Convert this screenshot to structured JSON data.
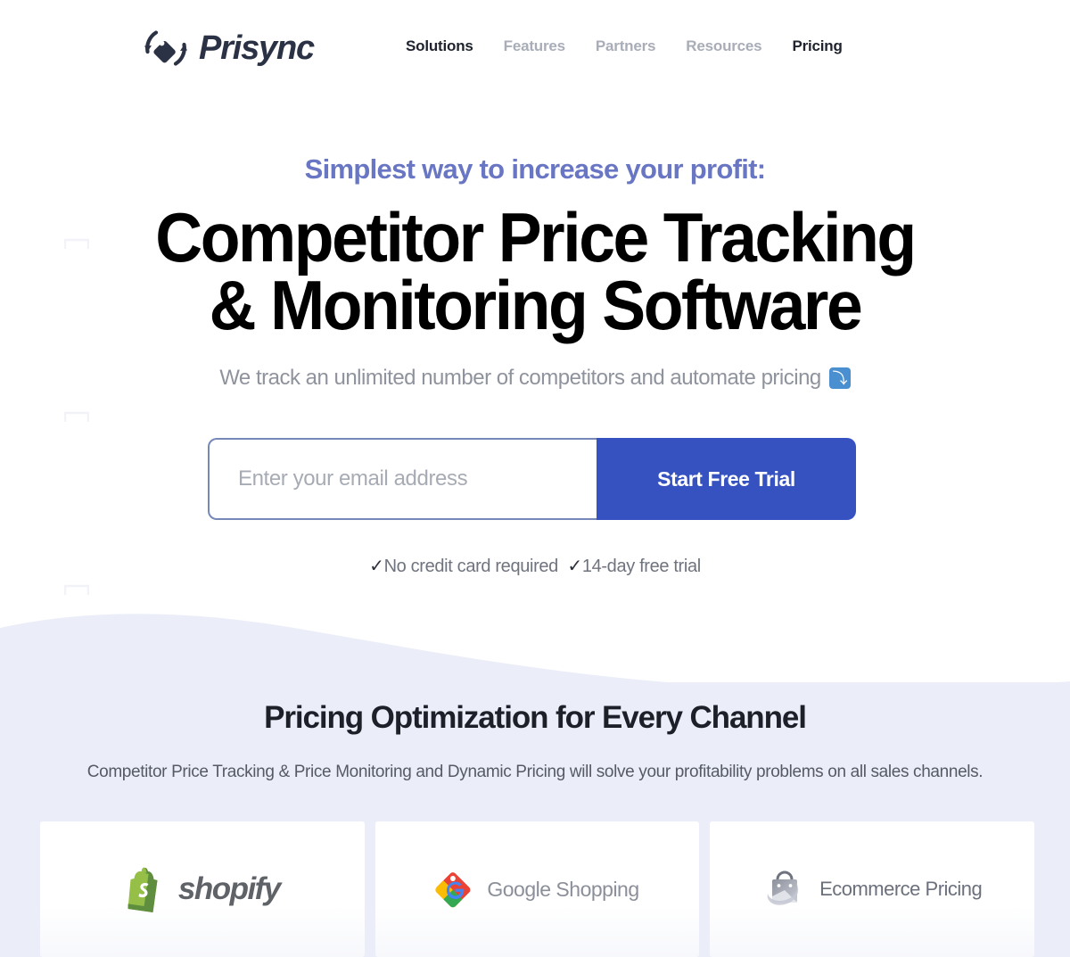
{
  "header": {
    "brand_name": "Prisync",
    "logo_icon": "prisync-tag-refresh-logo",
    "nav": [
      {
        "label": "Solutions",
        "active": true
      },
      {
        "label": "Features",
        "active": false
      },
      {
        "label": "Partners",
        "active": false
      },
      {
        "label": "Resources",
        "active": false
      },
      {
        "label": "Pricing",
        "active": true
      }
    ]
  },
  "hero": {
    "eyebrow": "Simplest way to increase your profit:",
    "headline_line1": "Competitor Price Tracking",
    "headline_line2": "& Monitoring Software",
    "subtitle": "We track an unlimited number of competitors and automate pricing",
    "subtitle_emoji": "⤵",
    "subtitle_emoji_name": "arrow-curving-down-emoji",
    "email_placeholder": "Enter your email address",
    "email_value": "",
    "cta_label": "Start Free Trial",
    "trust_tick": "✓",
    "trust_item1": "No credit card required",
    "trust_item2": "14-day free trial"
  },
  "channels": {
    "title": "Pricing Optimization for Every Channel",
    "description": "Competitor Price Tracking & Price Monitoring and Dynamic Pricing will solve your profitability problems on all sales channels.",
    "cards": [
      {
        "label": "shopify",
        "logo": "shopify-bag-logo"
      },
      {
        "label": "Google Shopping",
        "logo": "google-shopping-tag-logo"
      },
      {
        "label": "Ecommerce Pricing",
        "logo": "ecommerce-bag-logo"
      }
    ]
  },
  "colors": {
    "accent_blue": "#3652c0",
    "eyebrow_purple": "#6876c4",
    "section_bg": "#ebeef8",
    "brand_dark": "#2b3245",
    "emoji_badge_blue": "#4a90d0"
  }
}
